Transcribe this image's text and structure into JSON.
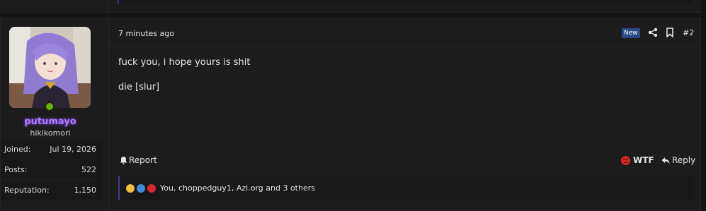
{
  "post": {
    "user": {
      "name": "putumayo",
      "title": "hikikomori",
      "stats": [
        {
          "label": "Joined:",
          "value": "Jul 19, 2026"
        },
        {
          "label": "Posts:",
          "value": "522"
        },
        {
          "label": "Reputation:",
          "value": "1,150"
        }
      ]
    },
    "time": "7 minutes ago",
    "badge": "New",
    "number": "#2",
    "body": [
      "fuck you, i hope yours is shit",
      "die [slur]"
    ],
    "actions": {
      "report": "Report",
      "wtf": "WTF",
      "reply": "Reply"
    },
    "reactions": {
      "summary": "You, choppedguy1, Azi.org and 3 others",
      "icons": [
        "sad-reaction-icon",
        "like-reaction-icon",
        "angry-reaction-icon"
      ]
    }
  },
  "colors": {
    "username": "#b07cff",
    "online": "#63b300",
    "badge": "#2b4a8a",
    "reaction_accent": "#4a3a8a"
  }
}
